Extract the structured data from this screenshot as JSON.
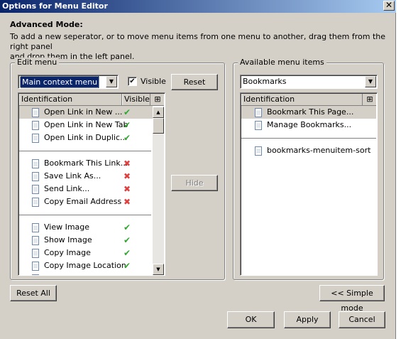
{
  "window": {
    "title": "Options for Menu Editor",
    "close_glyph": "✕"
  },
  "intro": {
    "heading": "Advanced Mode:",
    "line1": "To add a new seperator, or to move menu items from one menu to another, drag them from the right panel",
    "line2": "and drop them in the left panel."
  },
  "edit_menu": {
    "legend": "Edit menu",
    "selected_menu": "Main context menu",
    "visible_label": "Visible",
    "visible_checked": true,
    "reset_label": "Reset",
    "hide_label": "Hide",
    "columns": {
      "identification": "Identification",
      "visible": "Visible"
    },
    "rows": [
      {
        "label": "Open Link in New ...",
        "visible": true
      },
      {
        "label": "Open Link in New Tab",
        "visible": true
      },
      {
        "label": "Open Link in Duplic...",
        "visible": true
      },
      {
        "label": "Bookmark This Link...",
        "visible": false
      },
      {
        "label": "Save Link As...",
        "visible": false
      },
      {
        "label": "Send Link...",
        "visible": false
      },
      {
        "label": "Copy Email Address",
        "visible": false
      },
      {
        "label": "View Image",
        "visible": true
      },
      {
        "label": "Show Image",
        "visible": true
      },
      {
        "label": "Copy Image",
        "visible": true
      },
      {
        "label": "Copy Image Location",
        "visible": true
      }
    ]
  },
  "available": {
    "legend": "Available menu items",
    "selected_menu": "Bookmarks",
    "columns": {
      "identification": "Identification"
    },
    "rows": [
      {
        "label": "Bookmark This Page..."
      },
      {
        "label": "Manage Bookmarks..."
      },
      {
        "label": "bookmarks-menuitem-sort"
      }
    ]
  },
  "buttons": {
    "reset_all": "Reset All",
    "simple_mode": "<< Simple mode",
    "ok": "OK",
    "apply": "Apply",
    "cancel": "Cancel"
  },
  "colors": {
    "check": "#2fa82f",
    "cross": "#e04040",
    "title_bar": "#0a246a"
  }
}
